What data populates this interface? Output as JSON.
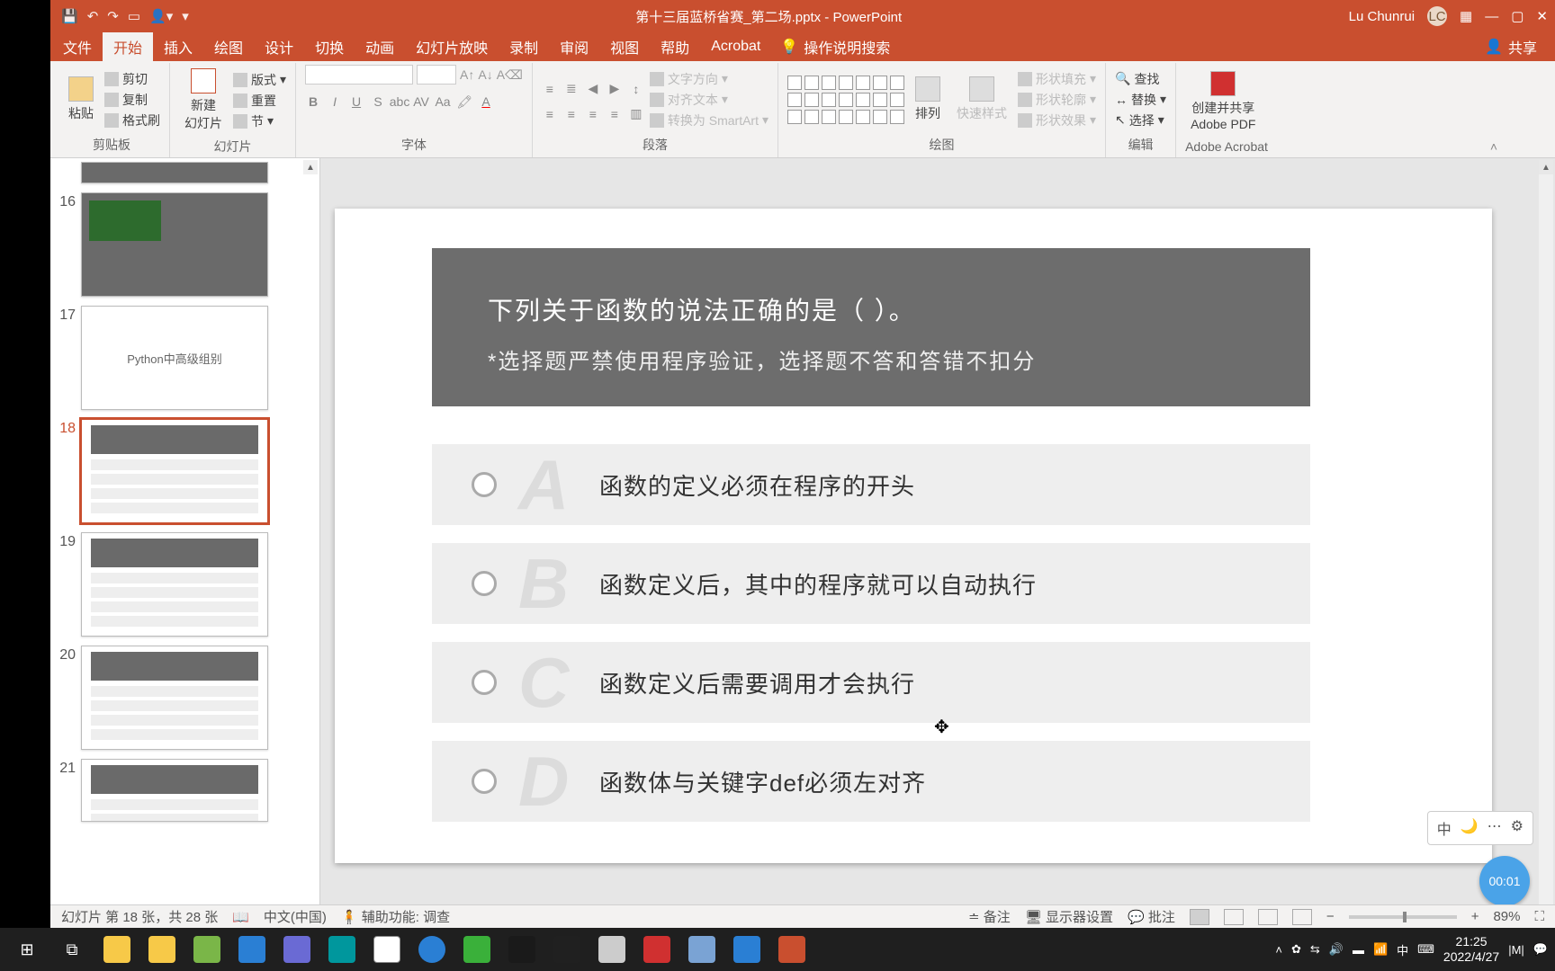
{
  "title": "第十三届蓝桥省赛_第二场.pptx - PowerPoint",
  "user_name": "Lu Chunrui",
  "user_initials": "LC",
  "tabs": {
    "file": "文件",
    "home": "开始",
    "insert": "插入",
    "draw": "绘图",
    "design": "设计",
    "transitions": "切换",
    "animations": "动画",
    "slideshow": "幻灯片放映",
    "record": "录制",
    "review": "审阅",
    "view": "视图",
    "help": "帮助",
    "acrobat": "Acrobat"
  },
  "search_hint": "操作说明搜索",
  "share": "共享",
  "ribbon": {
    "clipboard": {
      "paste": "粘贴",
      "cut": "剪切",
      "copy": "复制",
      "format_painter": "格式刷",
      "label": "剪贴板"
    },
    "slides": {
      "new_slide": "新建\n幻灯片",
      "layout": "版式",
      "reset": "重置",
      "section": "节",
      "label": "幻灯片"
    },
    "font": {
      "label": "字体"
    },
    "paragraph": {
      "text_direction": "文字方向",
      "align_text": "对齐文本",
      "convert_smartart": "转换为 SmartArt",
      "label": "段落"
    },
    "drawing": {
      "arrange": "排列",
      "quick_styles": "快速样式",
      "shape_fill": "形状填充",
      "shape_outline": "形状轮廓",
      "shape_effects": "形状效果",
      "label": "绘图"
    },
    "editing": {
      "find": "查找",
      "replace": "替换",
      "select": "选择",
      "label": "编辑"
    },
    "adobe": {
      "create_share": "创建并共享\nAdobe PDF",
      "label": "Adobe Acrobat"
    }
  },
  "thumbs": {
    "n16": "16",
    "n17": "17",
    "n18": "18",
    "n19": "19",
    "n20": "20",
    "n21": "21",
    "sec17_text": "Python中高级组别"
  },
  "slide": {
    "question": "下列关于函数的说法正确的是（  ）。",
    "note": "*选择题严禁使用程序验证，选择题不答和答错不扣分",
    "optA_letter": "A",
    "optA_text": "函数的定义必须在程序的开头",
    "optB_letter": "B",
    "optB_text": "函数定义后，其中的程序就可以自动执行",
    "optC_letter": "C",
    "optC_text": "函数定义后需要调用才会执行",
    "optD_letter": "D",
    "optD_text": "函数体与关键字def必须左对齐"
  },
  "rec_time": "00:01",
  "ime_badge": "中",
  "status": {
    "slide_info": "幻灯片 第 18 张，共 28 张",
    "language": "中文(中国)",
    "accessibility": "辅助功能: 调查",
    "notes": "备注",
    "display": "显示器设置",
    "comments": "批注",
    "zoom": "89%"
  },
  "taskbar": {
    "tray_ime": "中",
    "time": "21:25",
    "date": "2022/4/27"
  },
  "icon_colors": {
    "folder": "#f7c948",
    "explorer": "#f7c948",
    "notepad": "#4aa34a",
    "kwai": "#2a7fd4",
    "app1": "#6a6ad4",
    "app2": "#2aa37a",
    "chrome": "#fff",
    "globe": "#2a7fd4",
    "wechat": "#3ab03a",
    "pycharm": "#1a1a1a",
    "reader": "#c94f2f",
    "pdf": "#d03030",
    "picasa": "#7aa3d4",
    "bird": "#2a7fd4",
    "ppt": "#c94f2f",
    "ide": "#202020",
    "ard": "#00979d",
    "np": "#7ab648"
  }
}
